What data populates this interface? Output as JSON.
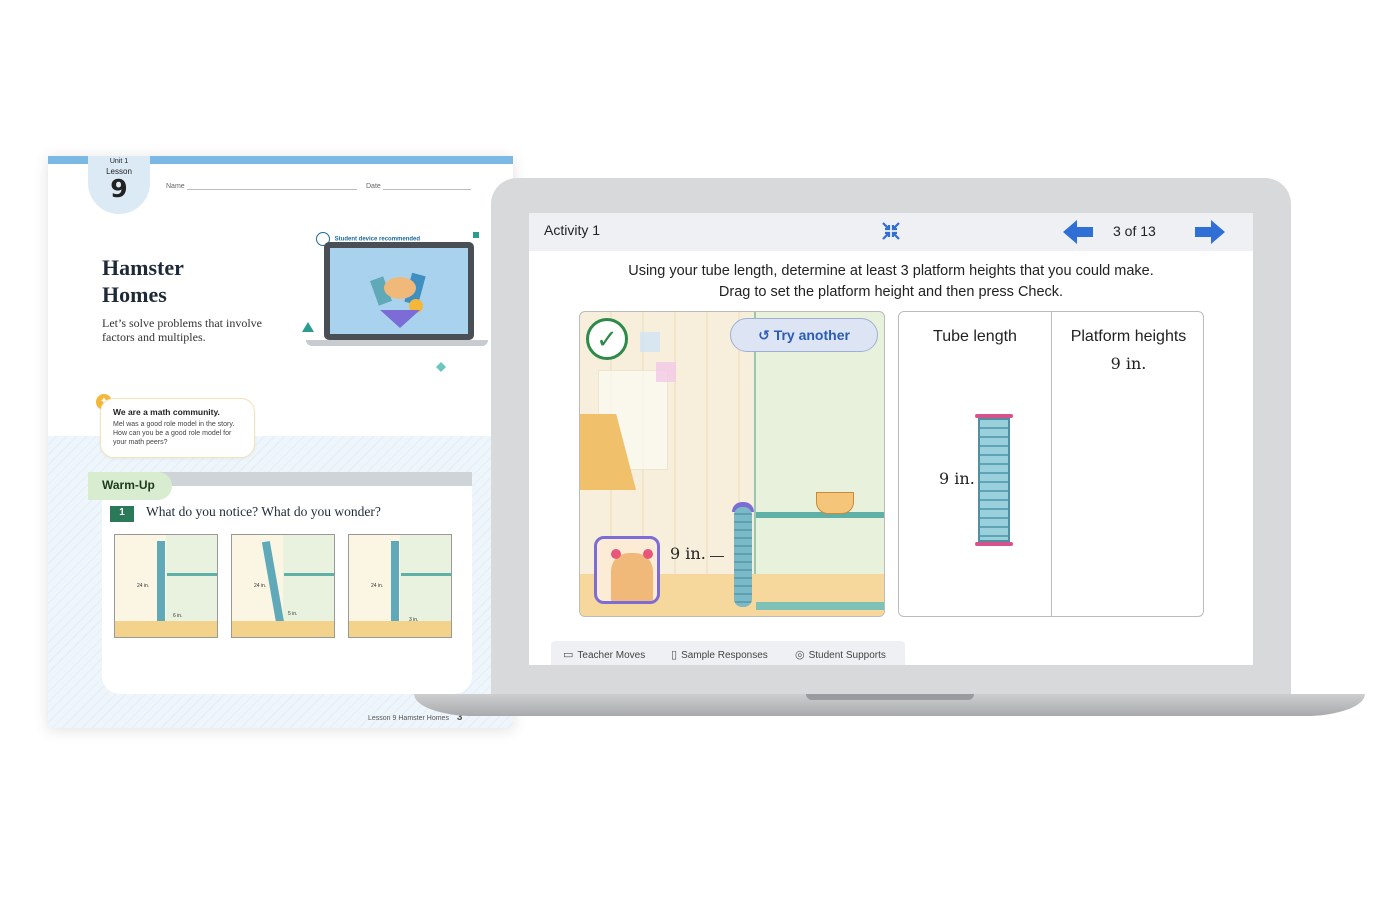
{
  "workbook": {
    "unit": "Unit 1",
    "lesson_label": "Lesson",
    "lesson_number": "9",
    "name_label": "Name",
    "date_label": "Date",
    "title": "Hamster Homes",
    "subtitle": "Let’s solve problems that involve factors and multiples.",
    "device_tag": "Student device recommended",
    "community": {
      "heading": "We are a math community.",
      "body": "Mel was a good role model in the story. How can you be a good role model for your math peers?"
    },
    "warmup_label": "Warm-Up",
    "question_number": "1",
    "question_text": "What do you notice? What do you wonder?",
    "thumbnails": [
      {
        "tube": "24 in.",
        "platform": "6 in."
      },
      {
        "tube": "24 in.",
        "platform": "5 in."
      },
      {
        "tube": "24 in.",
        "platform": "3 in."
      }
    ],
    "footer": {
      "lesson": "Lesson 9",
      "title": "Hamster Homes",
      "page": "3"
    }
  },
  "screen": {
    "activity_title": "Activity 1",
    "pagination": "3 of 13",
    "instruction_line1": "Using your tube length, determine at least 3 platform heights that you could make.",
    "instruction_line2": "Drag to set the platform height and then press Check.",
    "try_another_label": "Try another",
    "scene_platform_label": "9 in.",
    "table": {
      "col1_header": "Tube length",
      "col2_header": "Platform heights",
      "platform_values": [
        "9 in."
      ],
      "tube_label": "9 in."
    },
    "tabs": [
      {
        "label": "Teacher Moves",
        "icon": "teacher-icon"
      },
      {
        "label": "Sample Responses",
        "icon": "book-icon"
      },
      {
        "label": "Student Supports",
        "icon": "support-icon"
      }
    ]
  },
  "colors": {
    "accent_blue": "#2f6fd6",
    "check_green": "#2d8a4a",
    "warmup_green": "#d8ecd0",
    "tube_cap_pink": "#d6528a"
  }
}
